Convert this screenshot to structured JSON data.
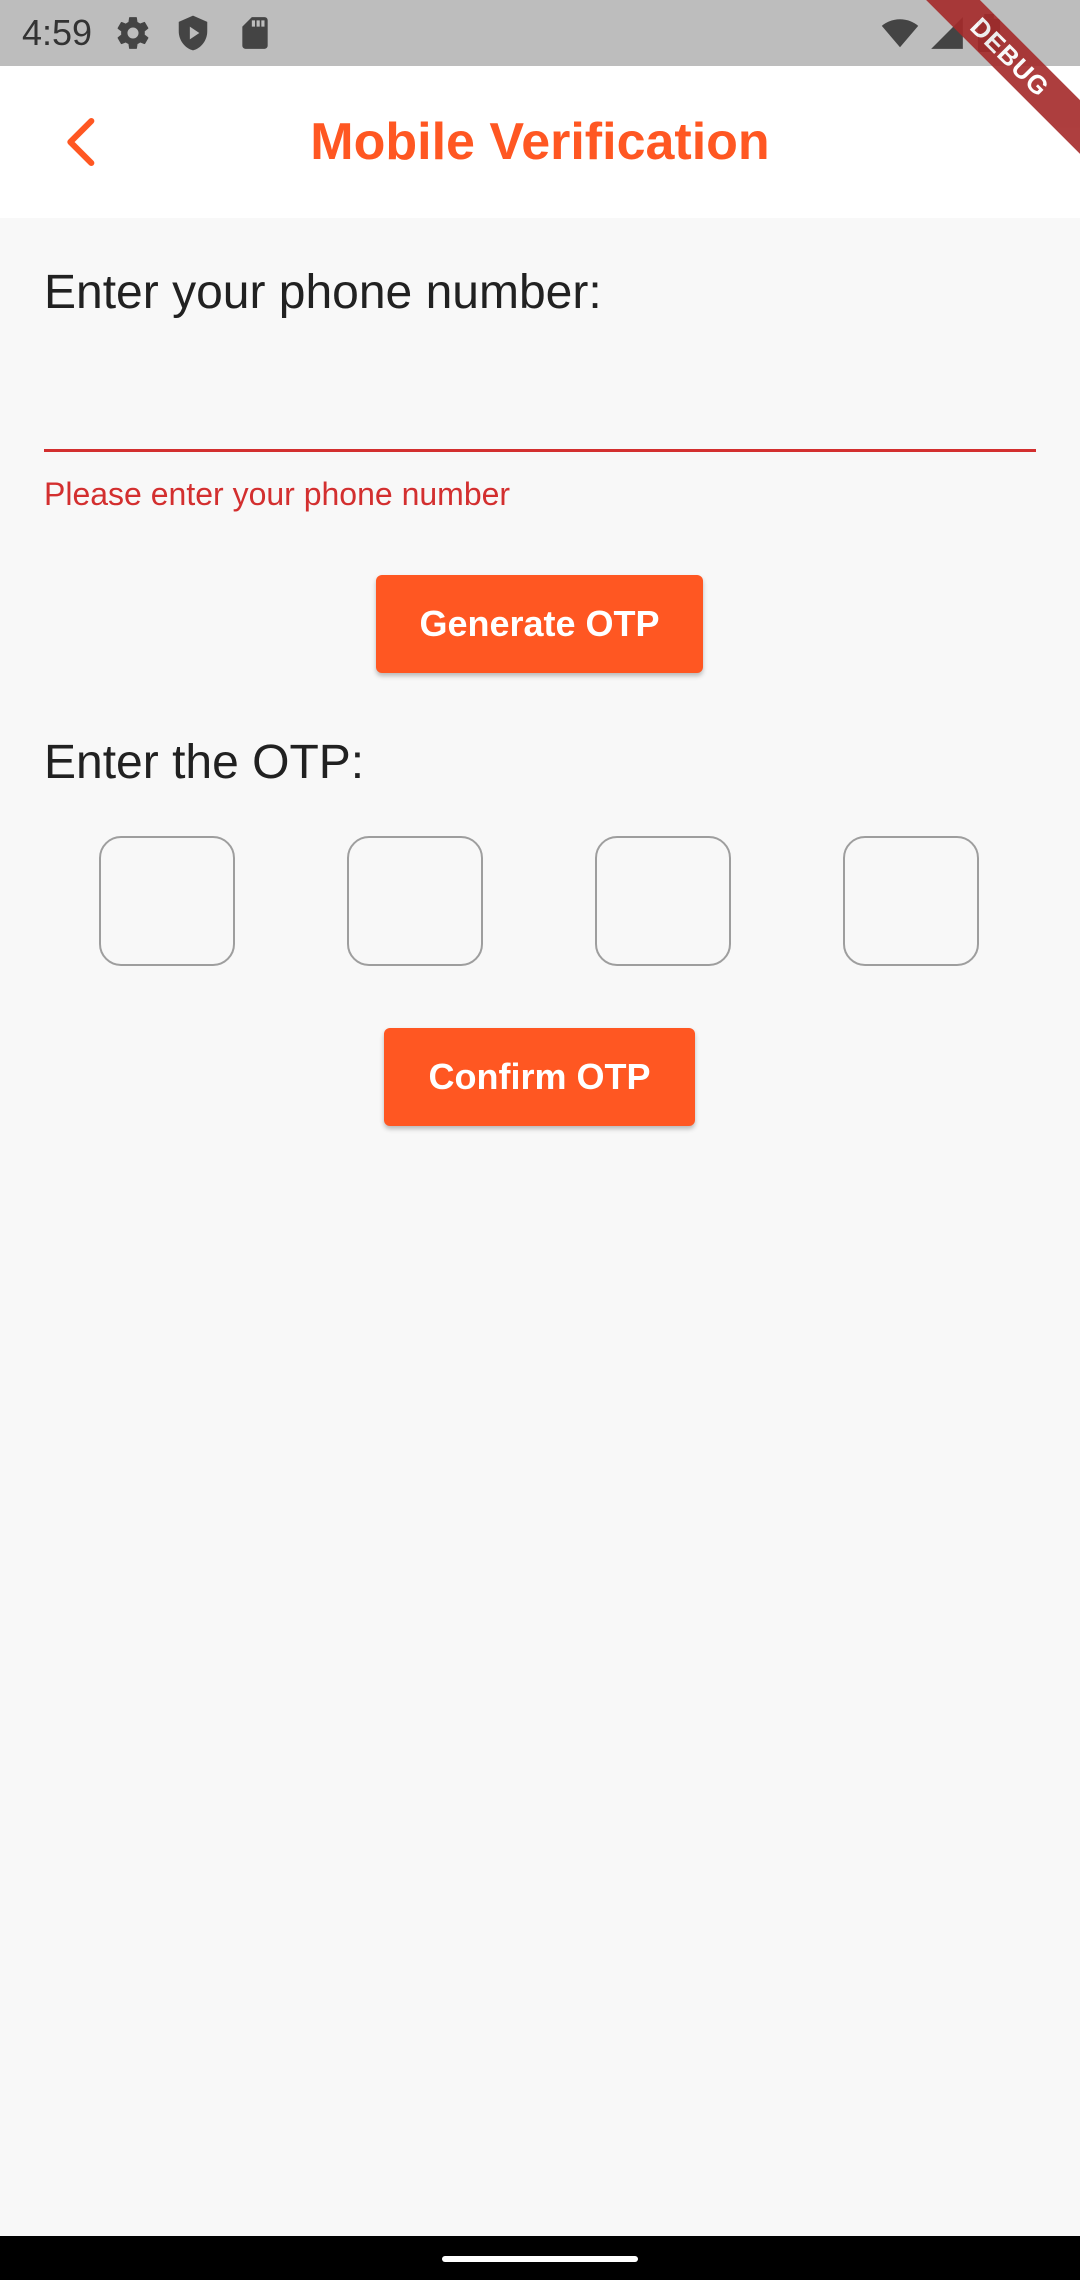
{
  "status_bar": {
    "time": "4:59",
    "left_icons": [
      "gear-icon",
      "play-protect-icon",
      "sd-card-icon"
    ],
    "right_icons": [
      "wifi-icon",
      "signal-icon",
      "battery-icon"
    ]
  },
  "debug_banner": {
    "label": "DEBUG"
  },
  "app_bar": {
    "title": "Mobile Verification",
    "back_icon": "chevron-left-icon",
    "accent_color": "#ff5722"
  },
  "phone_section": {
    "label": "Enter your phone number:",
    "input_value": "",
    "error": "Please enter your phone number",
    "error_color": "#d32f2f"
  },
  "generate_button": {
    "label": "Generate OTP"
  },
  "otp_section": {
    "label": "Enter the OTP:",
    "digits": [
      "",
      "",
      "",
      ""
    ]
  },
  "confirm_button": {
    "label": "Confirm OTP"
  }
}
